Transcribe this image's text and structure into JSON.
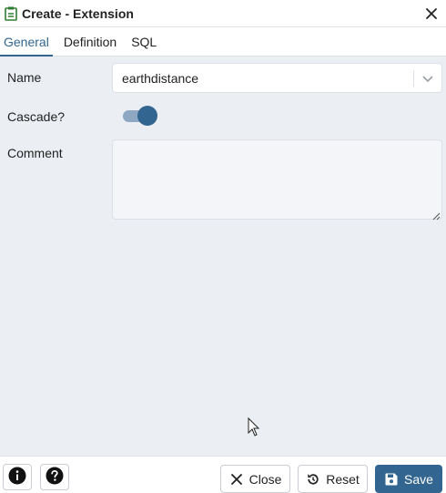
{
  "window": {
    "title": "Create - Extension",
    "icons": {
      "app": "extension-icon",
      "close": "close-icon"
    }
  },
  "tabs": [
    {
      "label": "General",
      "active": true
    },
    {
      "label": "Definition",
      "active": false
    },
    {
      "label": "SQL",
      "active": false
    }
  ],
  "form": {
    "name_label": "Name",
    "name_value": "earthdistance",
    "cascade_label": "Cascade?",
    "cascade_on": true,
    "comment_label": "Comment",
    "comment_value": ""
  },
  "footer": {
    "info_icon": "info-icon",
    "help_icon": "help-icon",
    "close_label": "Close",
    "reset_label": "Reset",
    "save_label": "Save"
  },
  "colors": {
    "accent": "#326690",
    "toggle_track": "#8ea8c4",
    "panel_bg": "#ebeef3",
    "border": "#dde0e6"
  }
}
